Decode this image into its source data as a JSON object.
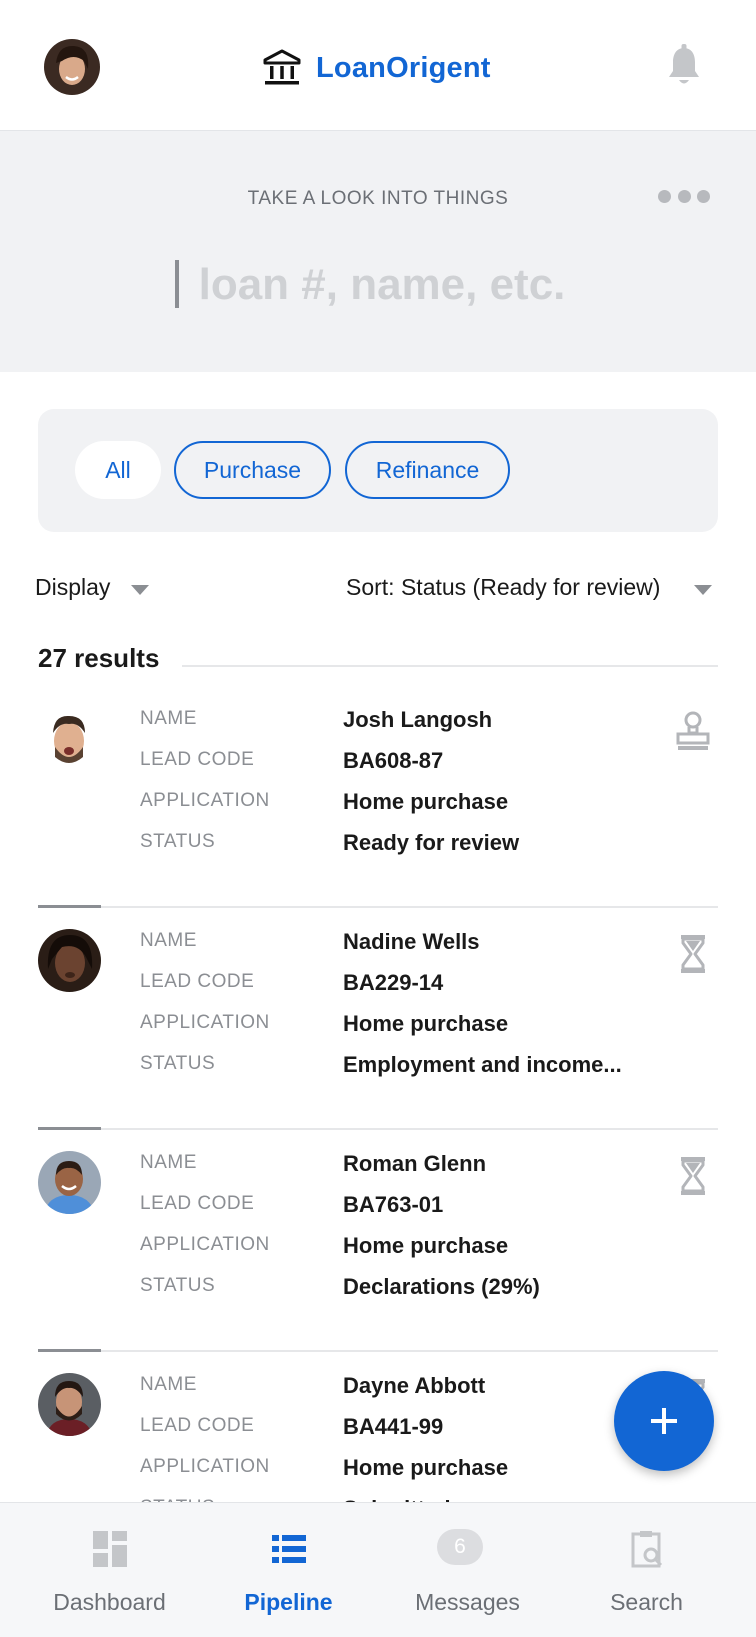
{
  "header": {
    "brand_name": "LoanOrigent",
    "icons": {
      "brand": "bank-icon",
      "notifications": "bell-icon",
      "avatar": "user-avatar"
    }
  },
  "search": {
    "caption": "TAKE A LOOK INTO THINGS",
    "placeholder": "loan #, name, etc.",
    "value": ""
  },
  "filters": {
    "chips": [
      "All",
      "Purchase",
      "Refinance"
    ],
    "selected": "All"
  },
  "controls": {
    "display_label": "Display",
    "sort_label": "Sort: Status (Ready for review)"
  },
  "results": {
    "count_label": "27 results",
    "field_labels": {
      "name": "NAME",
      "lead_code": "LEAD CODE",
      "application": "APPLICATION",
      "status": "STATUS"
    },
    "items": [
      {
        "name": "Josh Langosh",
        "lead_code": "BA608-87",
        "application": "Home purchase",
        "status": "Ready for review",
        "status_icon": "stamp-icon"
      },
      {
        "name": "Nadine Wells",
        "lead_code": "BA229-14",
        "application": "Home purchase",
        "status": "Employment and income...",
        "status_icon": "hourglass-icon"
      },
      {
        "name": "Roman Glenn",
        "lead_code": "BA763-01",
        "application": "Home purchase",
        "status": "Declarations (29%)",
        "status_icon": "hourglass-icon"
      },
      {
        "name": "Dayne Abbott",
        "lead_code": "BA441-99",
        "application": "Home purchase",
        "status": "Submitted",
        "status_icon": "hourglass-icon"
      }
    ]
  },
  "fab": {
    "icon": "plus-icon"
  },
  "bottom_nav": {
    "items": [
      {
        "label": "Dashboard",
        "icon": "dashboard-icon"
      },
      {
        "label": "Pipeline",
        "icon": "list-icon",
        "active": true
      },
      {
        "label": "Messages",
        "icon": "messages-icon",
        "badge": "6"
      },
      {
        "label": "Search",
        "icon": "search-clipboard-icon"
      }
    ]
  },
  "colors": {
    "accent": "#1266d4",
    "muted": "#8b8e93",
    "panel": "#f1f2f4"
  }
}
